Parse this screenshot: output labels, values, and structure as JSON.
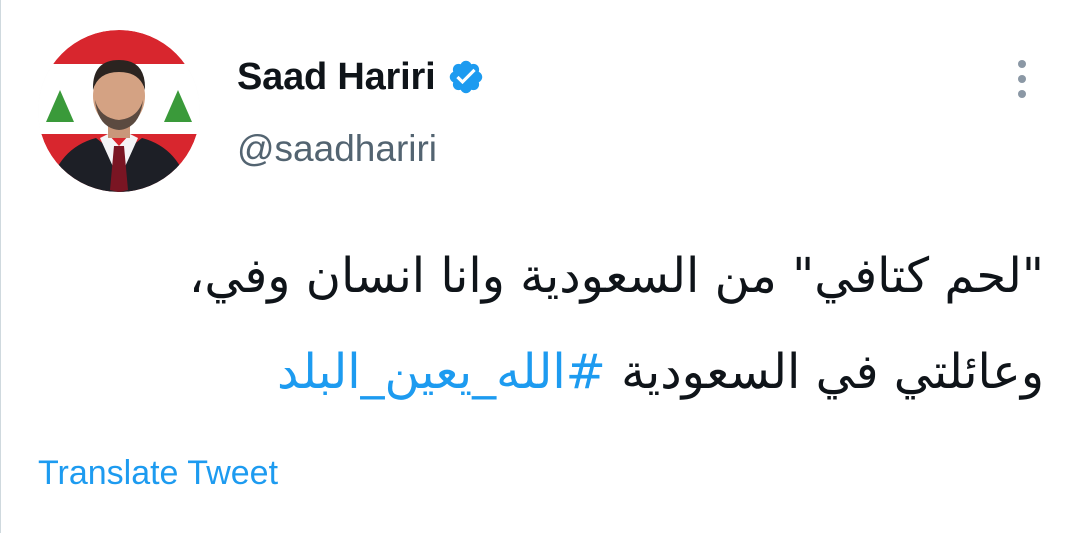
{
  "author": {
    "display_name": "Saad Hariri",
    "handle": "@saadhariri",
    "verified": true,
    "verified_icon": "verified-badge-icon"
  },
  "tweet": {
    "line1": "\"لحم كتافي\" من السعودية وانا انسان وفي،",
    "line2_text": "وعائلتي في السعودية ",
    "hashtag": "#الله_يعين_البلد"
  },
  "actions": {
    "translate_label": "Translate Tweet",
    "more_icon": "more-vertical-icon"
  },
  "colors": {
    "text": "#0f1419",
    "secondary": "#536471",
    "link": "#1d9bf0",
    "verified": "#1d9bf0"
  }
}
